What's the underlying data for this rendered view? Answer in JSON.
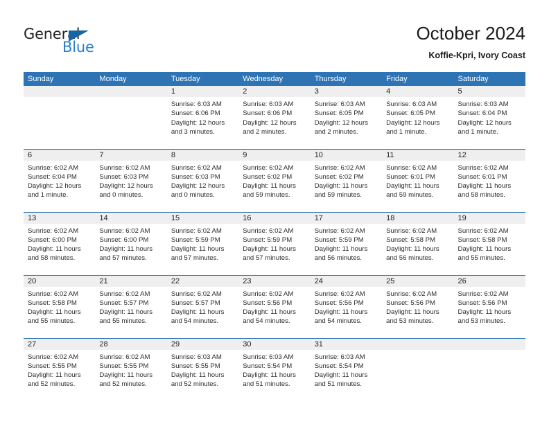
{
  "brand": {
    "name_top": "General",
    "name_bottom": "Blue",
    "triangle_color": "#1565a8",
    "blue_color": "#2a7fc9"
  },
  "header": {
    "title": "October 2024",
    "subtitle": "Koffie-Kpri, Ivory Coast"
  },
  "theme": {
    "header_blue": "#2e74b5",
    "daynum_band": "#efefef",
    "text": "#2c2c2c"
  },
  "weekdays": [
    "Sunday",
    "Monday",
    "Tuesday",
    "Wednesday",
    "Thursday",
    "Friday",
    "Saturday"
  ],
  "weeks": [
    [
      {
        "day": "",
        "sunrise": "",
        "sunset": "",
        "daylight_line1": "",
        "daylight_line2": ""
      },
      {
        "day": "",
        "sunrise": "",
        "sunset": "",
        "daylight_line1": "",
        "daylight_line2": ""
      },
      {
        "day": "1",
        "sunrise": "Sunrise: 6:03 AM",
        "sunset": "Sunset: 6:06 PM",
        "daylight_line1": "Daylight: 12 hours",
        "daylight_line2": "and 3 minutes."
      },
      {
        "day": "2",
        "sunrise": "Sunrise: 6:03 AM",
        "sunset": "Sunset: 6:06 PM",
        "daylight_line1": "Daylight: 12 hours",
        "daylight_line2": "and 2 minutes."
      },
      {
        "day": "3",
        "sunrise": "Sunrise: 6:03 AM",
        "sunset": "Sunset: 6:05 PM",
        "daylight_line1": "Daylight: 12 hours",
        "daylight_line2": "and 2 minutes."
      },
      {
        "day": "4",
        "sunrise": "Sunrise: 6:03 AM",
        "sunset": "Sunset: 6:05 PM",
        "daylight_line1": "Daylight: 12 hours",
        "daylight_line2": "and 1 minute."
      },
      {
        "day": "5",
        "sunrise": "Sunrise: 6:03 AM",
        "sunset": "Sunset: 6:04 PM",
        "daylight_line1": "Daylight: 12 hours",
        "daylight_line2": "and 1 minute."
      }
    ],
    [
      {
        "day": "6",
        "sunrise": "Sunrise: 6:02 AM",
        "sunset": "Sunset: 6:04 PM",
        "daylight_line1": "Daylight: 12 hours",
        "daylight_line2": "and 1 minute."
      },
      {
        "day": "7",
        "sunrise": "Sunrise: 6:02 AM",
        "sunset": "Sunset: 6:03 PM",
        "daylight_line1": "Daylight: 12 hours",
        "daylight_line2": "and 0 minutes."
      },
      {
        "day": "8",
        "sunrise": "Sunrise: 6:02 AM",
        "sunset": "Sunset: 6:03 PM",
        "daylight_line1": "Daylight: 12 hours",
        "daylight_line2": "and 0 minutes."
      },
      {
        "day": "9",
        "sunrise": "Sunrise: 6:02 AM",
        "sunset": "Sunset: 6:02 PM",
        "daylight_line1": "Daylight: 11 hours",
        "daylight_line2": "and 59 minutes."
      },
      {
        "day": "10",
        "sunrise": "Sunrise: 6:02 AM",
        "sunset": "Sunset: 6:02 PM",
        "daylight_line1": "Daylight: 11 hours",
        "daylight_line2": "and 59 minutes."
      },
      {
        "day": "11",
        "sunrise": "Sunrise: 6:02 AM",
        "sunset": "Sunset: 6:01 PM",
        "daylight_line1": "Daylight: 11 hours",
        "daylight_line2": "and 59 minutes."
      },
      {
        "day": "12",
        "sunrise": "Sunrise: 6:02 AM",
        "sunset": "Sunset: 6:01 PM",
        "daylight_line1": "Daylight: 11 hours",
        "daylight_line2": "and 58 minutes."
      }
    ],
    [
      {
        "day": "13",
        "sunrise": "Sunrise: 6:02 AM",
        "sunset": "Sunset: 6:00 PM",
        "daylight_line1": "Daylight: 11 hours",
        "daylight_line2": "and 58 minutes."
      },
      {
        "day": "14",
        "sunrise": "Sunrise: 6:02 AM",
        "sunset": "Sunset: 6:00 PM",
        "daylight_line1": "Daylight: 11 hours",
        "daylight_line2": "and 57 minutes."
      },
      {
        "day": "15",
        "sunrise": "Sunrise: 6:02 AM",
        "sunset": "Sunset: 5:59 PM",
        "daylight_line1": "Daylight: 11 hours",
        "daylight_line2": "and 57 minutes."
      },
      {
        "day": "16",
        "sunrise": "Sunrise: 6:02 AM",
        "sunset": "Sunset: 5:59 PM",
        "daylight_line1": "Daylight: 11 hours",
        "daylight_line2": "and 57 minutes."
      },
      {
        "day": "17",
        "sunrise": "Sunrise: 6:02 AM",
        "sunset": "Sunset: 5:59 PM",
        "daylight_line1": "Daylight: 11 hours",
        "daylight_line2": "and 56 minutes."
      },
      {
        "day": "18",
        "sunrise": "Sunrise: 6:02 AM",
        "sunset": "Sunset: 5:58 PM",
        "daylight_line1": "Daylight: 11 hours",
        "daylight_line2": "and 56 minutes."
      },
      {
        "day": "19",
        "sunrise": "Sunrise: 6:02 AM",
        "sunset": "Sunset: 5:58 PM",
        "daylight_line1": "Daylight: 11 hours",
        "daylight_line2": "and 55 minutes."
      }
    ],
    [
      {
        "day": "20",
        "sunrise": "Sunrise: 6:02 AM",
        "sunset": "Sunset: 5:58 PM",
        "daylight_line1": "Daylight: 11 hours",
        "daylight_line2": "and 55 minutes."
      },
      {
        "day": "21",
        "sunrise": "Sunrise: 6:02 AM",
        "sunset": "Sunset: 5:57 PM",
        "daylight_line1": "Daylight: 11 hours",
        "daylight_line2": "and 55 minutes."
      },
      {
        "day": "22",
        "sunrise": "Sunrise: 6:02 AM",
        "sunset": "Sunset: 5:57 PM",
        "daylight_line1": "Daylight: 11 hours",
        "daylight_line2": "and 54 minutes."
      },
      {
        "day": "23",
        "sunrise": "Sunrise: 6:02 AM",
        "sunset": "Sunset: 5:56 PM",
        "daylight_line1": "Daylight: 11 hours",
        "daylight_line2": "and 54 minutes."
      },
      {
        "day": "24",
        "sunrise": "Sunrise: 6:02 AM",
        "sunset": "Sunset: 5:56 PM",
        "daylight_line1": "Daylight: 11 hours",
        "daylight_line2": "and 54 minutes."
      },
      {
        "day": "25",
        "sunrise": "Sunrise: 6:02 AM",
        "sunset": "Sunset: 5:56 PM",
        "daylight_line1": "Daylight: 11 hours",
        "daylight_line2": "and 53 minutes."
      },
      {
        "day": "26",
        "sunrise": "Sunrise: 6:02 AM",
        "sunset": "Sunset: 5:56 PM",
        "daylight_line1": "Daylight: 11 hours",
        "daylight_line2": "and 53 minutes."
      }
    ],
    [
      {
        "day": "27",
        "sunrise": "Sunrise: 6:02 AM",
        "sunset": "Sunset: 5:55 PM",
        "daylight_line1": "Daylight: 11 hours",
        "daylight_line2": "and 52 minutes."
      },
      {
        "day": "28",
        "sunrise": "Sunrise: 6:02 AM",
        "sunset": "Sunset: 5:55 PM",
        "daylight_line1": "Daylight: 11 hours",
        "daylight_line2": "and 52 minutes."
      },
      {
        "day": "29",
        "sunrise": "Sunrise: 6:03 AM",
        "sunset": "Sunset: 5:55 PM",
        "daylight_line1": "Daylight: 11 hours",
        "daylight_line2": "and 52 minutes."
      },
      {
        "day": "30",
        "sunrise": "Sunrise: 6:03 AM",
        "sunset": "Sunset: 5:54 PM",
        "daylight_line1": "Daylight: 11 hours",
        "daylight_line2": "and 51 minutes."
      },
      {
        "day": "31",
        "sunrise": "Sunrise: 6:03 AM",
        "sunset": "Sunset: 5:54 PM",
        "daylight_line1": "Daylight: 11 hours",
        "daylight_line2": "and 51 minutes."
      },
      {
        "day": "",
        "sunrise": "",
        "sunset": "",
        "daylight_line1": "",
        "daylight_line2": ""
      },
      {
        "day": "",
        "sunrise": "",
        "sunset": "",
        "daylight_line1": "",
        "daylight_line2": ""
      }
    ]
  ]
}
